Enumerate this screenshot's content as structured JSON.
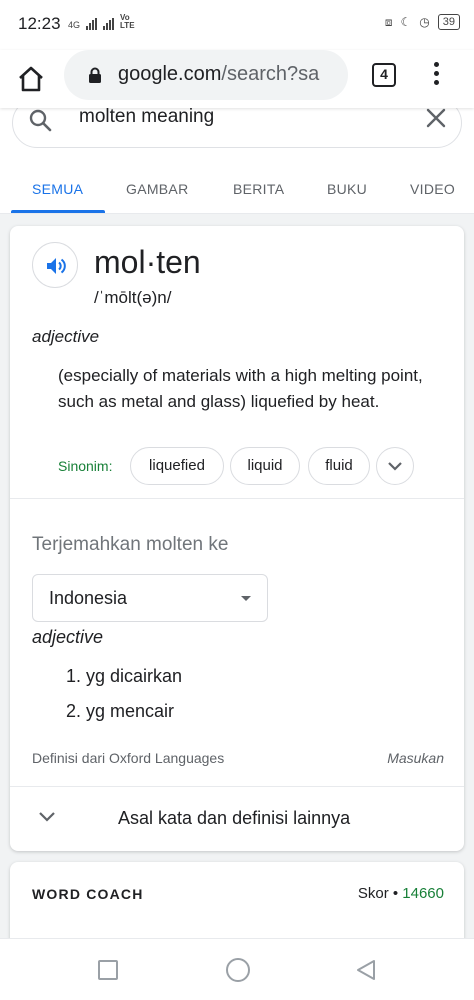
{
  "status_bar": {
    "time": "12:23",
    "network": "4G",
    "volte": "Vo LTE",
    "battery": "39"
  },
  "browser": {
    "url_host": "google.com",
    "url_path": "/search?sa",
    "tab_count": "4"
  },
  "search": {
    "query": "molten meaning"
  },
  "tabs": [
    {
      "label": "SEMUA",
      "active": true
    },
    {
      "label": "GAMBAR"
    },
    {
      "label": "BERITA"
    },
    {
      "label": "BUKU"
    },
    {
      "label": "VIDEO"
    }
  ],
  "dictionary": {
    "word": "mol·ten",
    "phonetic": "/ˈmōlt(ə)n/",
    "part_of_speech": "adjective",
    "definition": "(especially of materials with a high melting point, such as metal and glass) liquefied by heat.",
    "synonyms_label": "Sinonim:",
    "synonyms": [
      "liquefied",
      "liquid",
      "fluid"
    ],
    "translate_label": "Terjemahkan molten ke",
    "translate_language": "Indonesia",
    "translation_pos": "adjective",
    "translations": [
      "1. yg dicairkan",
      "2. yg mencair"
    ],
    "source": "Definisi dari Oxford Languages",
    "feedback": "Masukan",
    "more_label": "Asal kata dan definisi lainnya"
  },
  "word_coach": {
    "title": "WORD COACH",
    "score_label": "Skor •",
    "score_value": "14660"
  },
  "colors": {
    "accent_blue": "#1a73e8",
    "green": "#188038"
  }
}
